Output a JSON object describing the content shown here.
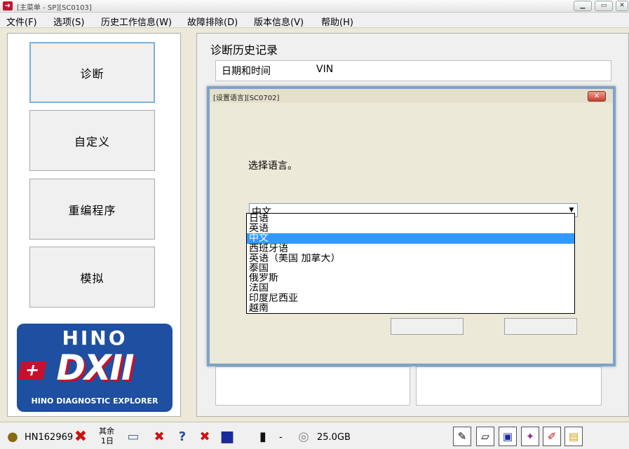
{
  "window": {
    "title": "[主菜单 - SP][SC0103]",
    "minimize": "▁",
    "maximize": "▭",
    "close": "✕"
  },
  "menu": [
    "文件(F)",
    "选项(S)",
    "历史工作信息(W)",
    "故障排除(D)",
    "版本信息(V)",
    "帮助(H)"
  ],
  "nav": {
    "diagnose": "诊断",
    "custom": "自定义",
    "reprogram": "重编程序",
    "simulate": "模拟"
  },
  "logo": {
    "brand": "HINO",
    "product": "DXII",
    "plus": "+",
    "subtitle": "HINO DIAGNOSTIC EXPLORER"
  },
  "history": {
    "title": "诊断历史记录",
    "col_datetime": "日期和时间",
    "col_vin": "VIN"
  },
  "dialog": {
    "title": "[设置语言][SC0702]",
    "close": "✕",
    "prompt": "选择语言。",
    "selected": "中文",
    "options": [
      "日语",
      "英语",
      "中文",
      "西班牙语",
      "英语（美国 加拿大）",
      "泰国",
      "俄罗斯",
      "法国",
      "印度尼西亚",
      "越南"
    ],
    "selected_index": 2
  },
  "status": {
    "user": "HN162969",
    "remaining_label": "其余",
    "remaining_value": "1日",
    "dash": "-",
    "disk": "25.0GB"
  },
  "colors": {
    "accent_blue": "#3399ff",
    "brand_blue": "#1e4fa0",
    "brand_red": "#c8102e"
  }
}
